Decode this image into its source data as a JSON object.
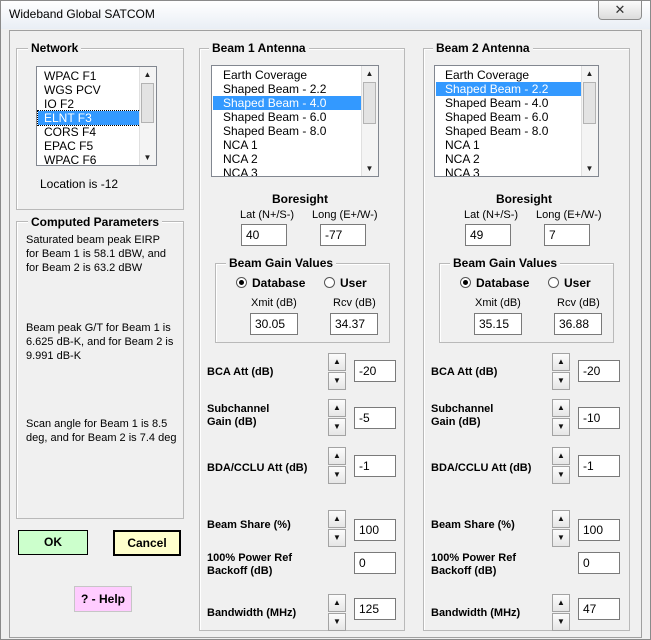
{
  "window": {
    "title": "Wideband Global SATCOM",
    "close_glyph": "✕"
  },
  "network": {
    "legend": "Network",
    "items": [
      "WPAC F1",
      "WGS PCV",
      "IO F2",
      "ELNT F3",
      "CORS F4",
      "EPAC F5",
      "WPAC F6"
    ],
    "location": "Location is -12"
  },
  "computed": {
    "legend": "Computed Parameters",
    "eirp": [
      "Saturated beam peak EIRP",
      "for Beam 1 is 58.1 dBW, and",
      "for Beam 2 is 63.2 dBW"
    ],
    "gt": [
      "Beam peak G/T for Beam 1 is",
      "6.625 dB-K, and for Beam 2 is",
      "9.991 dB-K"
    ],
    "scan": [
      "Scan angle for Beam 1 is 8.5",
      "deg, and for Beam 2 is 7.4 deg"
    ]
  },
  "buttons": {
    "ok": "OK",
    "cancel": "Cancel",
    "help": "? - Help"
  },
  "labels": {
    "boresight": "Boresight",
    "lat": "Lat (N+/S-)",
    "long": "Long (E+/W-)",
    "gain_values": "Beam Gain Values",
    "database": "Database",
    "user": "User",
    "xmit": "Xmit (dB)",
    "rcv": "Rcv (dB)",
    "bca": "BCA Att (dB)",
    "subchannel_1": "Subchannel",
    "subchannel_2": "Gain (dB)",
    "bda": "BDA/CCLU Att (dB)",
    "share": "Beam Share (%)",
    "powerref_1": "100% Power Ref",
    "powerref_2": "Backoff (dB)",
    "bandwidth": "Bandwidth (MHz)"
  },
  "beam1": {
    "legend": "Beam 1 Antenna",
    "list": [
      "Earth Coverage",
      "Shaped Beam - 2.2",
      "Shaped Beam - 4.0",
      "Shaped Beam - 6.0",
      "Shaped Beam - 8.0",
      "NCA 1",
      "NCA 2",
      "NCA 3"
    ],
    "lat": "40",
    "long": "-77",
    "xmit": "30.05",
    "rcv": "34.37",
    "bca": "-20",
    "subchannel": "-5",
    "bda": "-1",
    "share": "100",
    "powerref": "0",
    "bandwidth": "125"
  },
  "beam2": {
    "legend": "Beam 2 Antenna",
    "list": [
      "Earth Coverage",
      "Shaped Beam - 2.2",
      "Shaped Beam - 4.0",
      "Shaped Beam - 6.0",
      "Shaped Beam - 8.0",
      "NCA 1",
      "NCA 2",
      "NCA 3"
    ],
    "lat": "49",
    "long": "7",
    "xmit": "35.15",
    "rcv": "36.88",
    "bca": "-20",
    "subchannel": "-10",
    "bda": "-1",
    "share": "100",
    "powerref": "0",
    "bandwidth": "47"
  },
  "colors": {
    "selection": "#3399ff",
    "ok_button": "#ccffcc",
    "cancel_button": "#ffffcc",
    "help_button": "#ffccff"
  }
}
